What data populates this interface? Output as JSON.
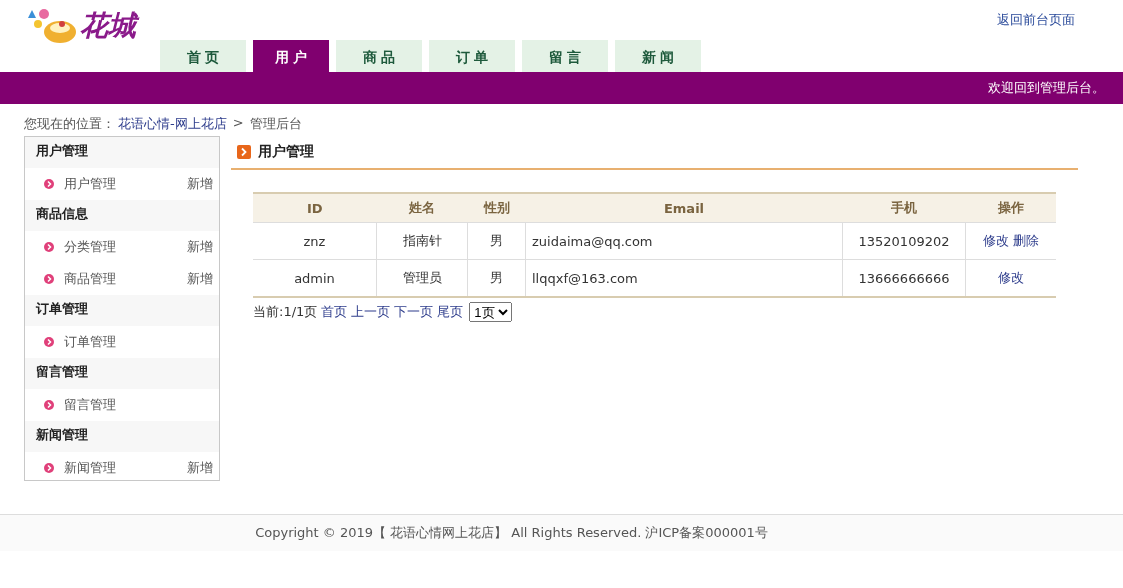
{
  "logo": {
    "text": "花城"
  },
  "back_link": "返回前台页面",
  "tabs": [
    {
      "label": "首 页",
      "selected": false
    },
    {
      "label": "用 户",
      "selected": true
    },
    {
      "label": "商 品",
      "selected": false
    },
    {
      "label": "订 单",
      "selected": false
    },
    {
      "label": "留 言",
      "selected": false
    },
    {
      "label": "新 闻",
      "selected": false
    }
  ],
  "welcome": "欢迎回到管理后台。",
  "breadcrumb": {
    "prefix": "您现在的位置：",
    "link": "花语心情-网上花店",
    "separator": ">",
    "current": "管理后台"
  },
  "sidebar": [
    {
      "title": "用户管理",
      "items": [
        {
          "label": "用户管理",
          "action": "新增"
        }
      ]
    },
    {
      "title": "商品信息",
      "items": [
        {
          "label": "分类管理",
          "action": "新增"
        },
        {
          "label": "商品管理",
          "action": "新增"
        }
      ]
    },
    {
      "title": "订单管理",
      "items": [
        {
          "label": "订单管理"
        }
      ]
    },
    {
      "title": "留言管理",
      "items": [
        {
          "label": "留言管理"
        }
      ]
    },
    {
      "title": "新闻管理",
      "items": [
        {
          "label": "新闻管理",
          "action": "新增"
        }
      ]
    }
  ],
  "section_title": "用户管理",
  "table": {
    "columns": [
      "ID",
      "姓名",
      "性别",
      "Email",
      "手机",
      "操作"
    ],
    "rows": [
      {
        "cells": [
          "znz",
          "指南针",
          "男",
          "zuidaima@qq.com",
          "13520109202"
        ],
        "actions": [
          "修改",
          "删除"
        ]
      },
      {
        "cells": [
          "admin",
          "管理员",
          "男",
          "llqqxf@163.com",
          "13666666666"
        ],
        "actions": [
          "修改"
        ]
      }
    ]
  },
  "pager": {
    "status": "当前:1/1页",
    "links": [
      "首页",
      "上一页",
      "下一页",
      "尾页"
    ],
    "select_value": "1页"
  },
  "footer": "Copyright © 2019【 花语心情网上花店】 All Rights Reserved. 沪ICP备案000001号"
}
